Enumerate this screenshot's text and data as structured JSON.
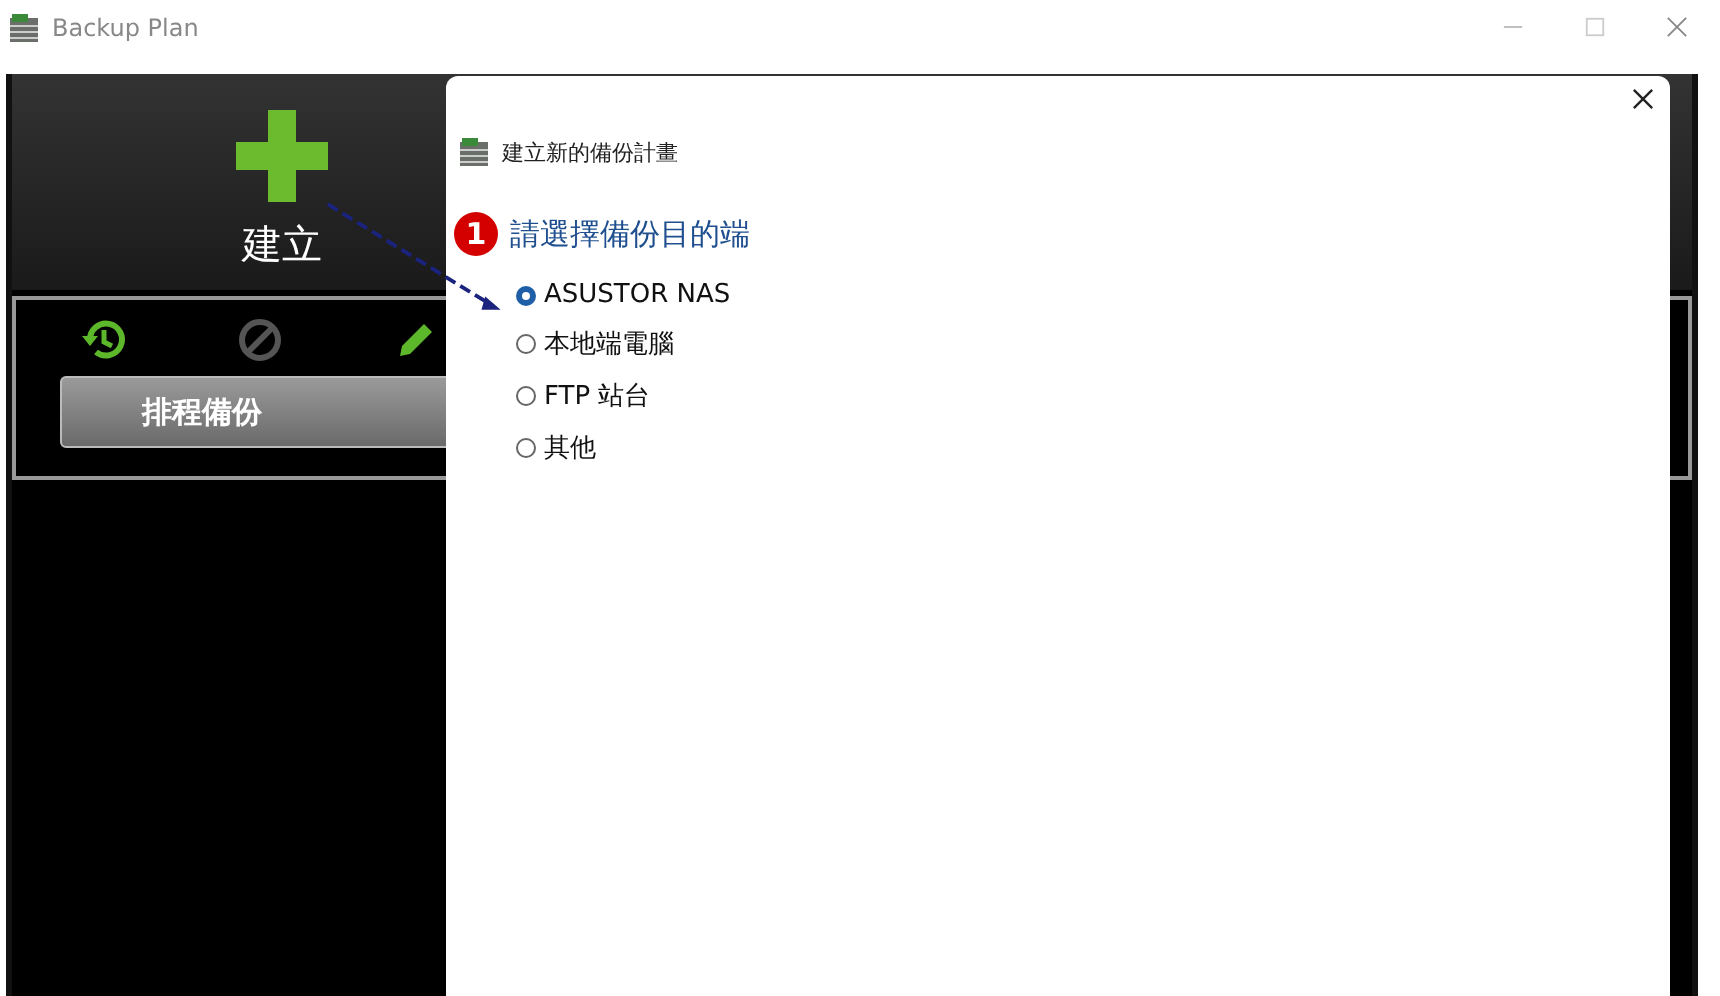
{
  "window": {
    "title": "Backup Plan"
  },
  "create": {
    "label": "建立"
  },
  "toolbar": {
    "button": "排程備份"
  },
  "dialog": {
    "title": "建立新的備份計畫",
    "step": {
      "number": "1",
      "label": "請選擇備份目的端"
    },
    "options": [
      {
        "label": "ASUSTOR NAS",
        "selected": true
      },
      {
        "label": "本地端電腦",
        "selected": false
      },
      {
        "label": "FTP 站台",
        "selected": false
      },
      {
        "label": "其他",
        "selected": false
      }
    ]
  }
}
